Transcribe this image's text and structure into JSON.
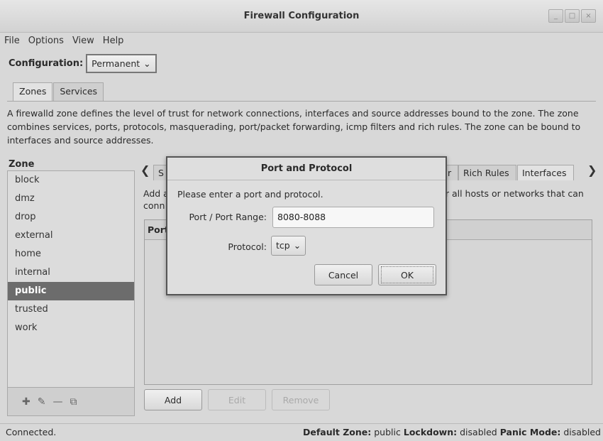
{
  "window": {
    "title": "Firewall Configuration",
    "controls": [
      "_",
      "□",
      "×"
    ]
  },
  "menu": [
    "File",
    "Options",
    "View",
    "Help"
  ],
  "configuration": {
    "label": "Configuration:",
    "value": "Permanent"
  },
  "tabs": [
    "Zones",
    "Services"
  ],
  "description": "A firewalld zone defines the level of trust for network connections, interfaces and source addresses bound to the zone. The zone combines services, ports, protocols, masquerading, port/packet forwarding, icmp filters and rich rules. The zone can be bound to interfaces and source addresses.",
  "zones": {
    "header": "Zone",
    "items": [
      "block",
      "dmz",
      "drop",
      "external",
      "home",
      "internal",
      "public",
      "trusted",
      "work"
    ],
    "selected": "public"
  },
  "zone_tabs": {
    "left_fragment": "S",
    "mid_fragment": "r",
    "rich_rules": "Rich Rules",
    "interfaces": "Interfaces"
  },
  "ports_panel": {
    "text_line1_left": "Add a",
    "text_line1_right": "r all hosts or networks that can",
    "text_line2_left": "conn",
    "column_header": "Port"
  },
  "buttons": {
    "add": "Add",
    "edit": "Edit",
    "remove": "Remove"
  },
  "status": {
    "connected": "Connected.",
    "default_zone_label": "Default Zone:",
    "default_zone_value": "public",
    "lockdown_label": "Lockdown:",
    "lockdown_value": "disabled",
    "panic_label": "Panic Mode:",
    "panic_value": "disabled"
  },
  "dialog": {
    "title": "Port and Protocol",
    "prompt": "Please enter a port and protocol.",
    "port_label": "Port / Port Range:",
    "port_value": "8080-8088",
    "protocol_label": "Protocol:",
    "protocol_value": "tcp",
    "cancel": "Cancel",
    "ok": "OK"
  }
}
